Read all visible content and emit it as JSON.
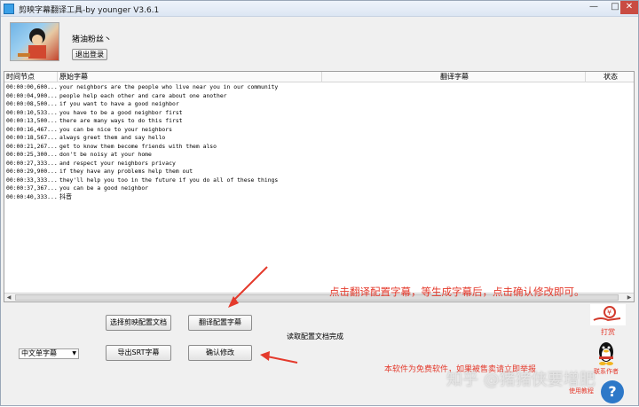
{
  "window": {
    "title": "剪映字幕翻译工具-by younger  V3.6.1",
    "minimize": "—",
    "maximize": "□",
    "close": "✕"
  },
  "user": {
    "name": "猪油粉丝丶",
    "logout_label": "退出登录"
  },
  "table": {
    "headers": [
      "时间节点",
      "原始字幕",
      "翻译字幕",
      "状态"
    ],
    "rows": [
      {
        "time": "00:00:00,600...",
        "orig": "your neighbors are the people who live near you in our community"
      },
      {
        "time": "00:00:04,900...",
        "orig": "people help each other and care about one another"
      },
      {
        "time": "00:00:08,500...",
        "orig": "if you want to have a good neighbor"
      },
      {
        "time": "00:00:10,533...",
        "orig": "you have to be a good neighbor first"
      },
      {
        "time": "00:00:13,500...",
        "orig": "there are many ways to do this first"
      },
      {
        "time": "00:00:16,467...",
        "orig": "you can be nice to your neighbors"
      },
      {
        "time": "00:00:18,567...",
        "orig": "always greet them and say hello"
      },
      {
        "time": "00:00:21,267...",
        "orig": "get to know them become friends with them also"
      },
      {
        "time": "00:00:25,300...",
        "orig": "don't be noisy at your home"
      },
      {
        "time": "00:00:27,333...",
        "orig": "and respect your neighbors privacy"
      },
      {
        "time": "00:00:29,900...",
        "orig": "if they have any problems help them out"
      },
      {
        "time": "00:00:33,333...",
        "orig": "they'll help you too in the future if you do all of these things"
      },
      {
        "time": "00:00:37,367...",
        "orig": "you can be a good neighbor"
      },
      {
        "time": "00:00:40,333...",
        "orig": "抖音"
      }
    ]
  },
  "buttons": {
    "select_config": "选择剪映配置文档",
    "translate_config": "翻译配置字幕",
    "export_srt": "导出SRT字幕",
    "confirm_modify": "确认修改"
  },
  "status_text": "读取配置文档完成",
  "subtitle_mode": {
    "selected": "中文单字幕"
  },
  "annotations": {
    "note1": "点击翻译配置字幕，等生成字幕后，点击确认修改即可。",
    "note2": "本软件为免费软件，如果被售卖请立即举报"
  },
  "side": {
    "dashang_label": "打赏",
    "qq_label": "联系作者",
    "usage_label": "使用教程"
  },
  "watermark": "知乎 @猪猪侠要增肥",
  "colors": {
    "annotation_red": "#e43a2c",
    "help_blue": "#2d78c8"
  },
  "icons": {
    "dashang": "hand-coin-icon",
    "qq": "penguin-icon",
    "help": "question-icon"
  }
}
